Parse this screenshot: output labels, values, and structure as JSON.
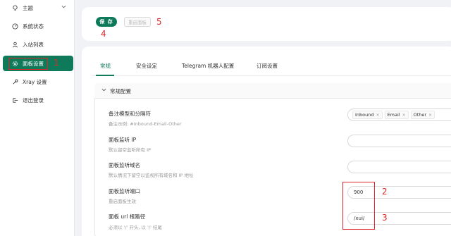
{
  "sidebar": {
    "items": [
      {
        "label": "主题",
        "icon": "bulb-icon"
      },
      {
        "label": "系统状态",
        "icon": "dashboard-icon"
      },
      {
        "label": "入站列表",
        "icon": "user-icon"
      },
      {
        "label": "面板设置",
        "icon": "gear-icon"
      },
      {
        "label": "Xray 设置",
        "icon": "wrench-icon"
      },
      {
        "label": "退出登录",
        "icon": "logout-icon"
      }
    ]
  },
  "toolbar": {
    "save_label": "保 存",
    "restart_label": "重启面板"
  },
  "tabs": [
    "常规",
    "安全设定",
    "Telegram 机器人配置",
    "订阅设置"
  ],
  "section": {
    "title": "常规配置"
  },
  "settings": [
    {
      "label": "备注模型和分隔符",
      "desc": "备注示例: #Inbound-Email-Other"
    },
    {
      "label": "面板监听 IP",
      "desc": "默认留空监听所有 IP"
    },
    {
      "label": "面板监听域名",
      "desc": "默认情况下留空以监视所有域名和 IP 地址"
    },
    {
      "label": "面板监听端口",
      "desc": "重启面板生效"
    },
    {
      "label": "面板 url 根路径",
      "desc": "必须以 '/' 开头, 以 '/' 结尾"
    }
  ],
  "remark_tags": [
    "Inbound",
    "Email",
    "Other"
  ],
  "port_value": "900",
  "path_value": "/xui/",
  "annotations": [
    "1",
    "2",
    "3",
    "4",
    "5"
  ],
  "colors": {
    "accent": "#0f7a5a",
    "annotation": "#e0262a"
  }
}
